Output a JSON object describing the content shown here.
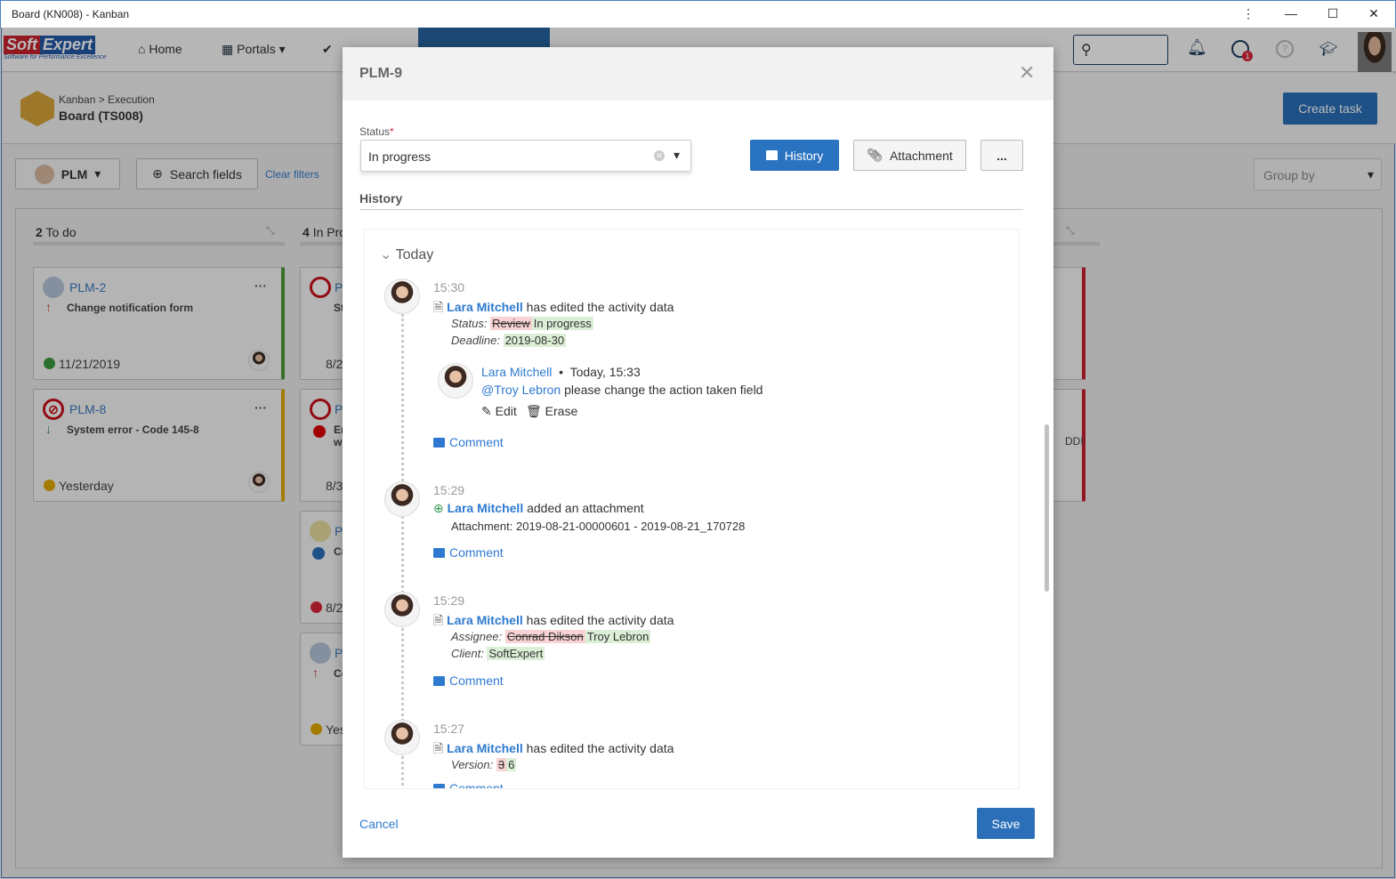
{
  "window": {
    "title": "Board (KN008) - Kanban",
    "controls": [
      "more-vertical",
      "minimize",
      "maximize",
      "close"
    ]
  },
  "nav": {
    "logo": "SoftExpert",
    "logo_tagline": "Software for Performance Excellence",
    "items": [
      {
        "label": "Home",
        "icon": "home-icon"
      },
      {
        "label": "Portals",
        "icon": "grid-icon"
      },
      {
        "label": "",
        "icon": "check-icon"
      }
    ],
    "notification_count": "1"
  },
  "header": {
    "breadcrumb": "Kanban > Execution",
    "title": "Board (TS008)",
    "create_task": "Create task"
  },
  "filters": {
    "project": "PLM",
    "search_fields": "Search fields",
    "clear_filters": "Clear filters",
    "group_by": "Group by"
  },
  "columns": [
    {
      "title_count": "2",
      "title": "To do",
      "cards": [
        {
          "id": "PLM-2",
          "title": "Change notification form",
          "date": "11/21/2019",
          "color": "#4a9a3a"
        },
        {
          "id": "PLM-8",
          "title": "System error - Code 145-8",
          "date": "Yesterday",
          "color": "#e2a800"
        }
      ]
    },
    {
      "title_count": "4",
      "title": "In Pro",
      "cards": [
        {
          "id": "P",
          "title": "St",
          "date": "8/2"
        },
        {
          "id": "P",
          "title": "Er",
          "title2": "w",
          "date": "8/3"
        },
        {
          "id": "P",
          "title": "Cr",
          "date": "8/2"
        },
        {
          "id": "P",
          "title": "Co",
          "date": "Yes"
        }
      ]
    },
    {
      "cards": [
        {
          "title": ""
        },
        {
          "title": "DDI"
        }
      ]
    }
  ],
  "modal": {
    "title": "PLM-9",
    "status_label": "Status",
    "required_mark": "*",
    "status_value": "In progress",
    "tabs": {
      "history": "History",
      "attachment": "Attachment",
      "more": "..."
    },
    "section_title": "History",
    "group": "Today",
    "entries": [
      {
        "time": "15:30",
        "user": "Lara Mitchell",
        "action": "has edited the activity data",
        "icon": "edit-doc-icon",
        "fields": [
          {
            "label": "Status:",
            "old": "Review",
            "new": "In progress"
          },
          {
            "label": "Deadline:",
            "new": "2019-08-30"
          }
        ],
        "comment": {
          "user": "Lara Mitchell",
          "sep": "•",
          "when": "Today, 15:33",
          "mention": "@Troy Lebron",
          "text": "please change the action taken field",
          "edit": "Edit",
          "erase": "Erase"
        },
        "comment_link": "Comment"
      },
      {
        "time": "15:29",
        "user": "Lara Mitchell",
        "action": "added an attachment",
        "icon": "attachment-add-icon",
        "detail": "Attachment: 2019-08-21-00000601 - 2019-08-21_170728",
        "comment_link": "Comment"
      },
      {
        "time": "15:29",
        "user": "Lara Mitchell",
        "action": "has edited the activity data",
        "icon": "edit-doc-icon",
        "fields": [
          {
            "label": "Assignee:",
            "old": "Conrad Dikson",
            "new": "Troy Lebron"
          },
          {
            "label": "Client:",
            "new": "SoftExpert"
          }
        ],
        "comment_link": "Comment"
      },
      {
        "time": "15:27",
        "user": "Lara Mitchell",
        "action": "has edited the activity data",
        "icon": "edit-doc-icon",
        "fields": [
          {
            "label": "Version:",
            "old": "3",
            "new": "6"
          }
        ],
        "comment_link": "Comment"
      }
    ],
    "cancel": "Cancel",
    "save": "Save"
  },
  "colors": {
    "primary": "#2a6fb8",
    "link": "#2f7ad0",
    "old_value": "#f9d3d3",
    "new_value": "#dbeed6"
  }
}
